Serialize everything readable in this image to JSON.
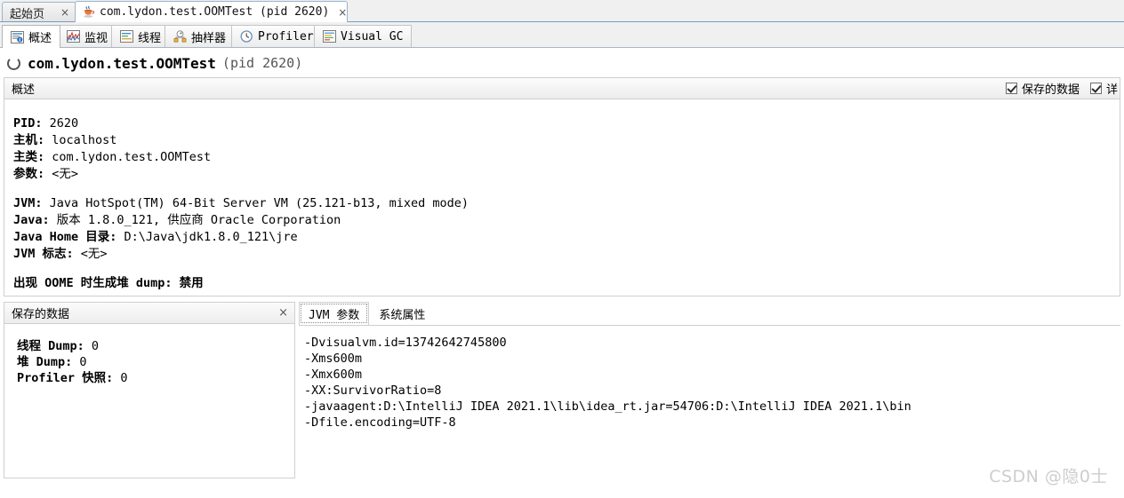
{
  "document_tabs": [
    {
      "label": "起始页",
      "icon": "none",
      "active": false,
      "close_label": "×"
    },
    {
      "label": "com.lydon.test.OOMTest (pid 2620)",
      "icon": "java-coffee-icon",
      "active": true,
      "close_label": "×"
    }
  ],
  "sub_tabs": [
    {
      "label": "概述",
      "icon": "overview-icon",
      "selected": true
    },
    {
      "label": "监视",
      "icon": "monitor-chart-icon",
      "selected": false
    },
    {
      "label": "线程",
      "icon": "threads-icon",
      "selected": false
    },
    {
      "label": "抽样器",
      "icon": "sampler-icon",
      "selected": false
    },
    {
      "label": "Profiler",
      "icon": "profiler-clock-icon",
      "selected": false
    },
    {
      "label": "Visual GC",
      "icon": "visual-gc-icon",
      "selected": false
    }
  ],
  "app_header": {
    "name": "com.lydon.test.OOMTest",
    "pid_text": "(pid 2620)",
    "icon": "app-loading-icon"
  },
  "overview_bar": {
    "title": "概述",
    "checkboxes": [
      {
        "label": "保存的数据",
        "checked": true
      },
      {
        "label": "详",
        "checked": true
      }
    ]
  },
  "overview_details": [
    {
      "key": "PID:",
      "value": " 2620"
    },
    {
      "key": "主机:",
      "value": " localhost"
    },
    {
      "key": "主类:",
      "value": " com.lydon.test.OOMTest"
    },
    {
      "key": "参数:",
      "value": " <无>"
    },
    {
      "key": "",
      "value": ""
    },
    {
      "key": "JVM:",
      "value": " Java HotSpot(TM) 64-Bit Server VM (25.121-b13, mixed mode)"
    },
    {
      "key": "Java:",
      "value": " 版本 1.8.0_121, 供应商 Oracle Corporation"
    },
    {
      "key": "Java Home 目录:",
      "value": " D:\\Java\\jdk1.8.0_121\\jre"
    },
    {
      "key": "JVM 标志:",
      "value": " <无>"
    },
    {
      "key": "",
      "value": ""
    },
    {
      "key": "出现 OOME 时生成堆 dump:",
      "value": " 禁用"
    }
  ],
  "saved_data_pane": {
    "title": "保存的数据",
    "close_label": "×",
    "rows": [
      {
        "key": "线程 Dump:",
        "value": " 0"
      },
      {
        "key": "堆 Dump:",
        "value": " 0"
      },
      {
        "key": "Profiler 快照:",
        "value": " 0"
      }
    ]
  },
  "jvm_pane": {
    "tabs": [
      {
        "label": "JVM 参数",
        "selected": true
      },
      {
        "label": "系统属性",
        "selected": false
      }
    ],
    "arguments": [
      "-Dvisualvm.id=13742642745800",
      "-Xms600m",
      "-Xmx600m",
      "-XX:SurvivorRatio=8",
      "-javaagent:D:\\IntelliJ IDEA 2021.1\\lib\\idea_rt.jar=54706:D:\\IntelliJ IDEA 2021.1\\bin",
      "-Dfile.encoding=UTF-8"
    ]
  },
  "watermark": "CSDN @隐0士"
}
